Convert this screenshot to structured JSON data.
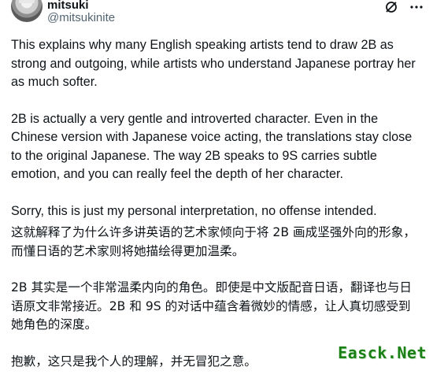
{
  "post": {
    "display_name": "mitsuki",
    "handle": "@mitsukinite",
    "paragraphs_en": [
      "This explains why many English speaking artists tend to draw 2B as strong and outgoing, while artists who understand Japanese portray her as much softer.",
      "2B is actually a very gentle and introverted character. Even in the Chinese version with Japanese voice acting, the translations stay close to the original Japanese. The way 2B speaks to 9S carries subtle emotion, and you can really feel the depth of her character.",
      "Sorry, this is just my personal interpretation, no offense intended."
    ],
    "paragraphs_zh": [
      "这就解释了为什么许多讲英语的艺术家倾向于将 2B 画成坚强外向的形象，而懂日语的艺术家则将她描绘得更加温柔。",
      "2B 其实是一个非常温柔内向的角色。即使是中文版配音日语，翻译也与日语原文非常接近。2B 和 9S 的对话中蕴含着微妙的情感，让人真切感受到她角色的深度。",
      "抱歉，这只是我个人的理解，并无冒犯之意。"
    ]
  },
  "icons": {
    "grok": "grok-icon",
    "more": "more-options-icon"
  },
  "watermark": "Easck.Net"
}
